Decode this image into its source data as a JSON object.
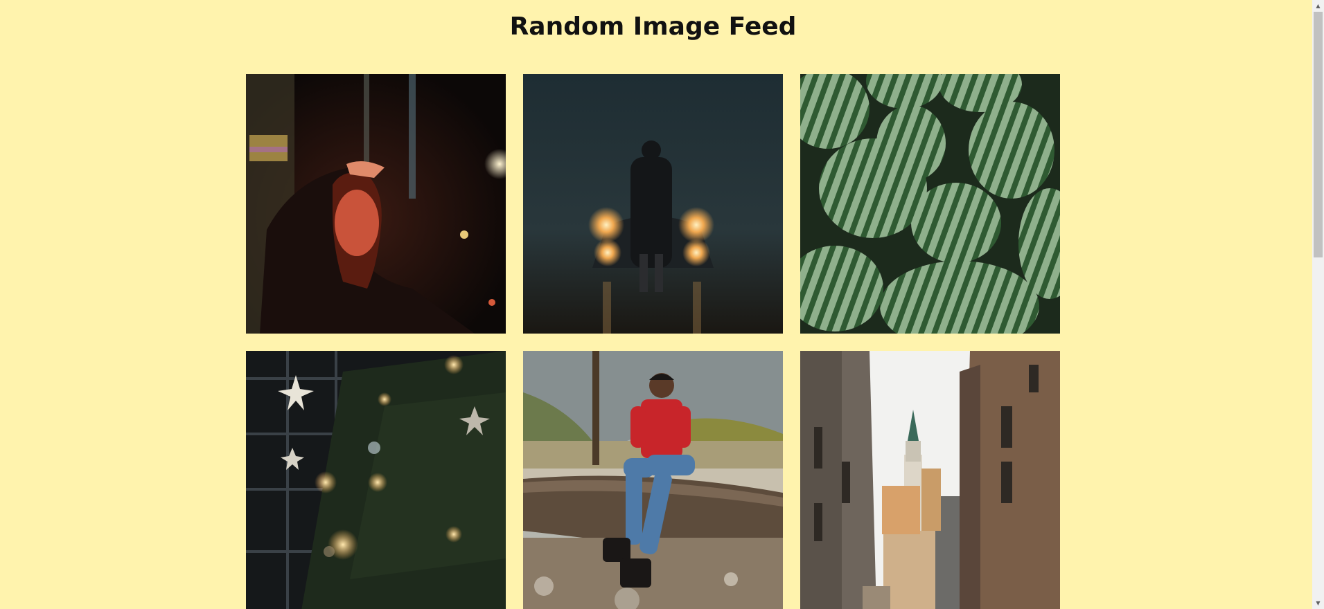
{
  "page": {
    "title": "Random Image Feed"
  },
  "colors": {
    "background": "#fff3ad",
    "title": "#111111"
  },
  "feed": {
    "images": [
      {
        "subject": "woman-portrait-night"
      },
      {
        "subject": "man-car-headlights-fog"
      },
      {
        "subject": "watermelons"
      },
      {
        "subject": "christmas-tree-lights"
      },
      {
        "subject": "man-sitting-on-log"
      },
      {
        "subject": "narrow-street-tower"
      }
    ]
  },
  "scrollbar": {
    "up_icon": "▲",
    "down_icon": "▼",
    "position": 0
  }
}
